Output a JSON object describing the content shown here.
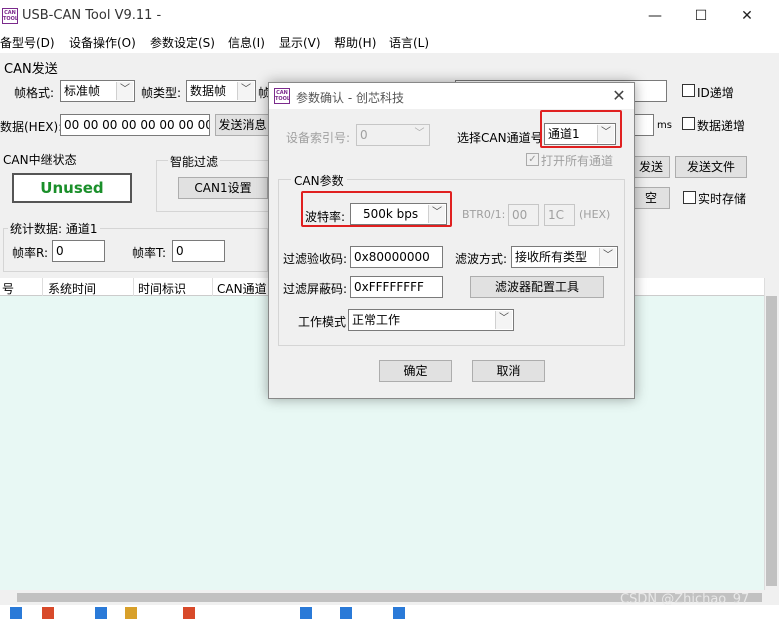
{
  "window": {
    "title": "USB-CAN Tool V9.11 -",
    "icon_text": "CAN TOOL",
    "minimize": "—",
    "maximize": "☐",
    "close": "✕"
  },
  "menu": [
    "备型号(D)",
    "设备操作(O)",
    "参数设定(S)",
    "信息(I)",
    "显示(V)",
    "帮助(H)",
    "语言(L)"
  ],
  "send_panel": {
    "title": "CAN发送",
    "frame_format_label": "帧格式:",
    "frame_format_value": "标准帧",
    "frame_type_label": "帧类型:",
    "frame_type_value": "数据帧",
    "frame_id_label_fragment": "帧",
    "data_label": "数据(HEX):",
    "data_value": "00 00 00 00 00 00 00 00",
    "send_button_fragment": "发送消息",
    "id_increment": "ID递增",
    "data_increment": "数据递增",
    "ms_unit": "ms",
    "send_button_right_fragment": "发送",
    "send_file_button": "发送文件",
    "clear_button_fragment": "空",
    "realtime_save": "实时存储"
  },
  "relay": {
    "label": "CAN中继状态",
    "status": "Unused",
    "status_color": "#1a8f2a"
  },
  "smart_filter": {
    "label": "智能过滤",
    "can1_button": "CAN1设置"
  },
  "stats": {
    "label": "统计数据:",
    "channel": "通道1",
    "rate_r_label": "帧率R:",
    "rate_r_value": "0",
    "rate_t_label": "帧率T:",
    "rate_t_value": "0"
  },
  "table": {
    "columns": [
      "号",
      "系统时间",
      "时间标识",
      "CAN通道"
    ]
  },
  "watermark": "CSDN @Zhichao_97",
  "dialog": {
    "title": "参数确认 - 创芯科技",
    "device_index_label": "设备索引号:",
    "device_index_value": "0",
    "select_channel_label": "选择CAN通道号:",
    "select_channel_value": "通道1",
    "open_all_channels": "打开所有通道",
    "can_params_group": "CAN参数",
    "baud_label": "波特率:",
    "baud_value": "500k bps",
    "btr_label": "BTR0/1:",
    "btr0_value": "00",
    "btr1_value": "1C",
    "hex_label": "(HEX)",
    "acc_code_label": "过滤验收码:",
    "acc_code_value": "0x80000000",
    "filter_mode_label": "滤波方式:",
    "filter_mode_value": "接收所有类型",
    "mask_label": "过滤屏蔽码:",
    "mask_value": "0xFFFFFFFF",
    "filter_config_button": "滤波器配置工具",
    "work_mode_label": "工作模式",
    "work_mode_value": "正常工作",
    "ok_button": "确定",
    "cancel_button": "取消",
    "highlight_color": "#e02020"
  }
}
